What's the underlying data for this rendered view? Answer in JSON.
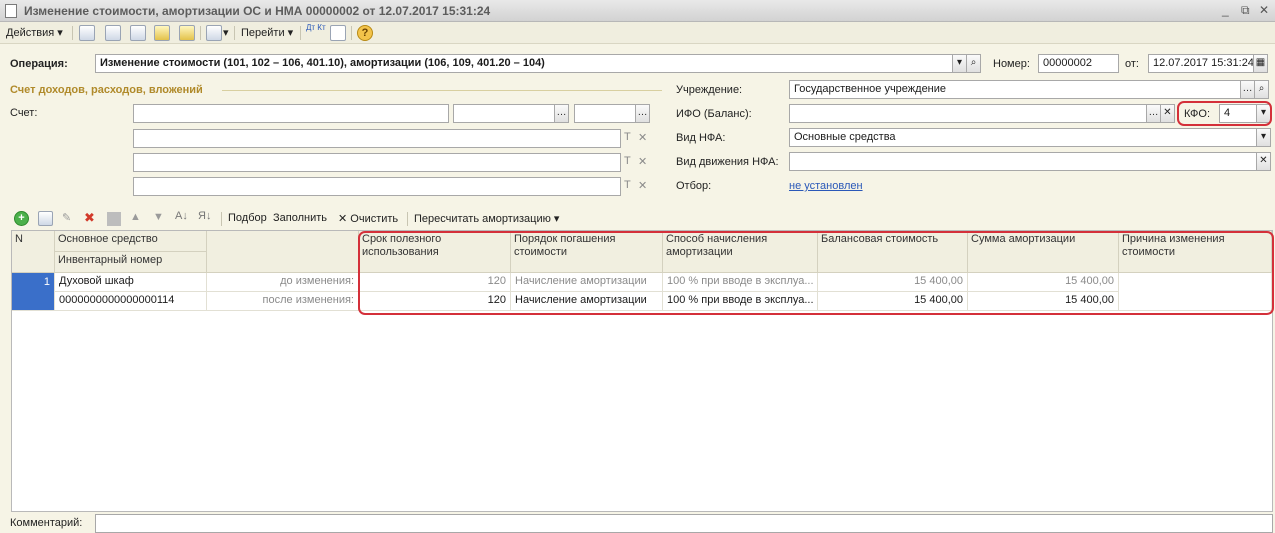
{
  "window": {
    "title": "Изменение стоимости, амортизации ОС и НМА 00000002 от 12.07.2017 15:31:24",
    "controls": [
      "_",
      "⧉",
      "✕"
    ]
  },
  "toolbar": {
    "actions_label": "Действия",
    "goto_label": "Перейти",
    "dtkt_label": "Дт Кт",
    "help_label": "?"
  },
  "header": {
    "operation_label": "Операция:",
    "operation_value": "Изменение стоимости (101, 102 – 106, 401.10), амортизации (106, 109, 401.20 – 104)",
    "number_label": "Номер:",
    "number_value": "00000002",
    "date_label": "от:",
    "date_value": "12.07.2017 15:31:24"
  },
  "account_section": {
    "title": "Счет доходов, расходов, вложений",
    "account_label": "Счет:"
  },
  "right_panel": {
    "institution_label": "Учреждение:",
    "institution_value": "Государственное учреждение",
    "ifo_label": "ИФО (Баланс):",
    "ifo_value": "",
    "kfo_label": "КФО:",
    "kfo_value": "4",
    "nfa_type_label": "Вид НФА:",
    "nfa_type_value": "Основные средства",
    "nfa_move_label": "Вид движения НФА:",
    "nfa_move_value": "",
    "filter_label": "Отбор:",
    "filter_value": "не установлен"
  },
  "table_toolbar": {
    "pick_label": "Подбор",
    "fill_label": "Заполнить",
    "clear_label": "Очистить",
    "recalc_label": "Пересчитать амортизацию"
  },
  "table": {
    "headers": {
      "n": "N",
      "asset": "Основное средство",
      "inventory": "Инвентарный номер",
      "life": "Срок полезного использования",
      "repay": "Порядок погашения стоимости",
      "method": "Способ начисления амортизации",
      "balance": "Балансовая стоимость",
      "amort": "Сумма амортизации",
      "reason": "Причина изменения стоимости"
    },
    "row": {
      "n": "1",
      "asset": "Духовой шкаф",
      "inventory": "0000000000000000114",
      "before_label": "до изменения:",
      "after_label": "после изменения:",
      "before": {
        "life": "120",
        "repay": "Начисление амортизации",
        "method": "100 % при вводе в эксплуа...",
        "balance": "15 400,00",
        "amort": "15 400,00"
      },
      "after": {
        "life": "120",
        "repay": "Начисление амортизации",
        "method": "100 % при вводе в эксплуа...",
        "balance": "15 400,00",
        "amort": "15 400,00"
      }
    }
  },
  "footer": {
    "comment_label": "Комментарий:",
    "comment_value": ""
  },
  "colors": {
    "highlight": "#d4303a",
    "selection": "#3a6fc9",
    "section_title": "#b08a2a"
  }
}
